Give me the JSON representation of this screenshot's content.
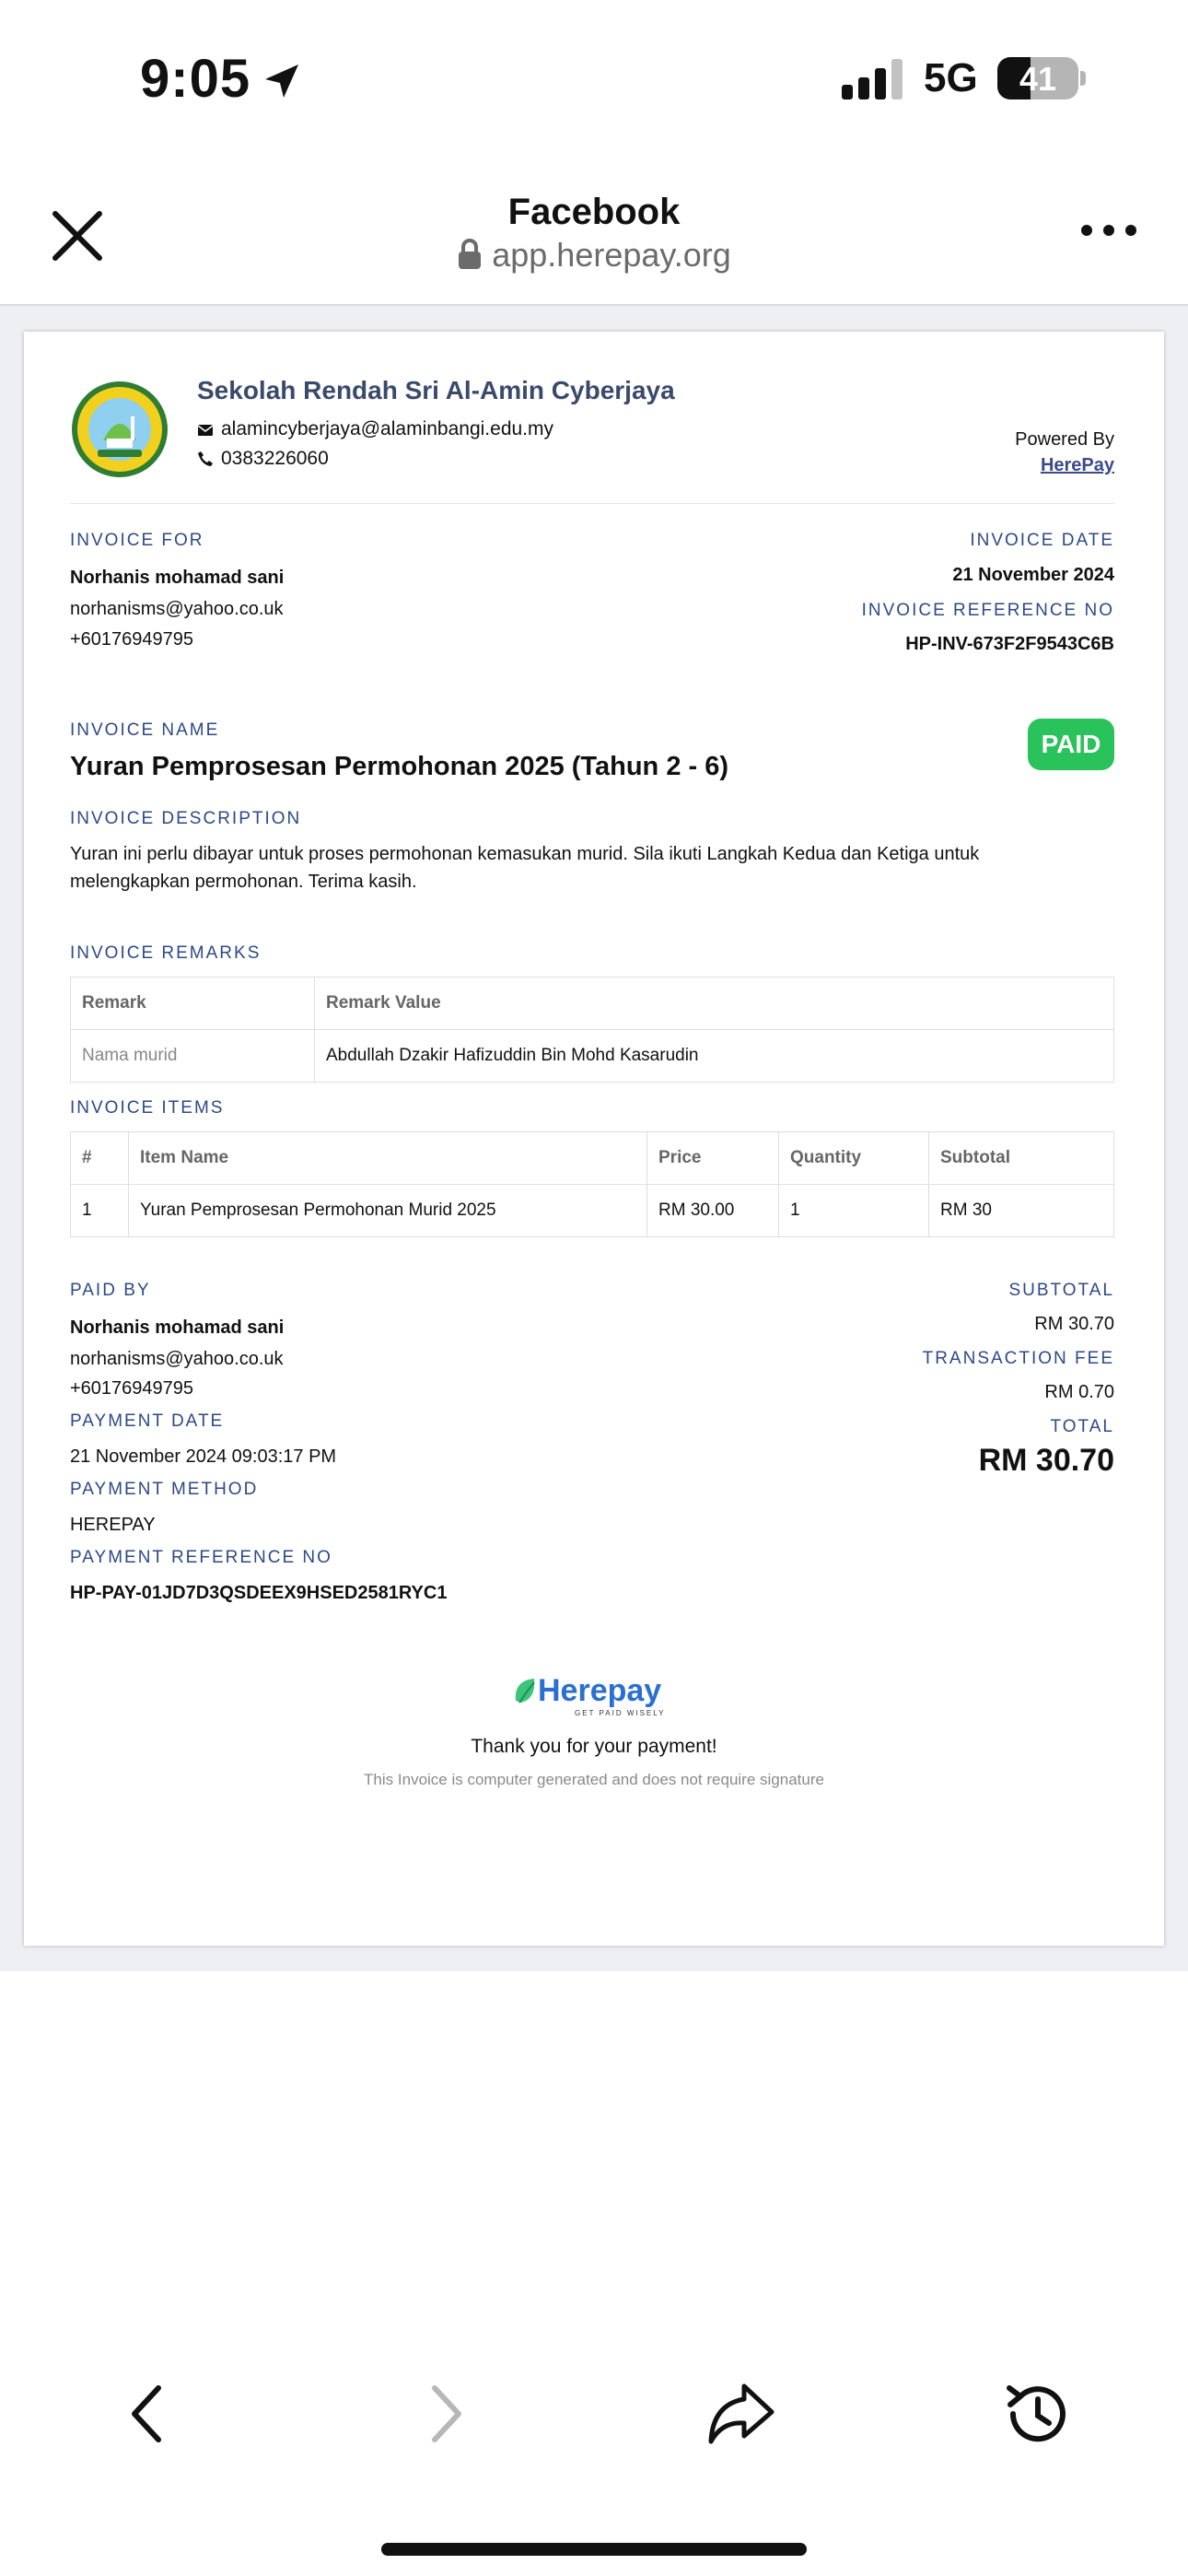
{
  "status_bar": {
    "time": "9:05",
    "network": "5G",
    "battery": "41",
    "battery_level": 0.41
  },
  "browser": {
    "title": "Facebook",
    "url": "app.herepay.org"
  },
  "invoice": {
    "school_name": "Sekolah Rendah Sri Al-Amin Cyberjaya",
    "school_email": "alamincyberjaya@alaminbangi.edu.my",
    "school_phone": "0383226060",
    "powered_by": "Powered By",
    "powered_link": "HerePay",
    "invoice_for_label": "INVOICE FOR",
    "customer_name": "Norhanis mohamad sani",
    "customer_email": "norhanisms@yahoo.co.uk",
    "customer_phone": "+60176949795",
    "invoice_date_label": "INVOICE DATE",
    "invoice_date": "21 November 2024",
    "ref_label": "INVOICE REFERENCE NO",
    "ref_no": "HP-INV-673F2F9543C6B",
    "name_label": "INVOICE NAME",
    "invoice_name": "Yuran Pemprosesan Permohonan 2025 (Tahun 2 - 6)",
    "status": "PAID",
    "desc_label": "INVOICE DESCRIPTION",
    "description": "Yuran ini perlu dibayar untuk proses permohonan kemasukan murid. Sila ikuti Langkah Kedua dan Ketiga untuk melengkapkan permohonan. Terima kasih.",
    "remarks_label": "INVOICE REMARKS",
    "remarks_headers": [
      "Remark",
      "Remark Value"
    ],
    "remarks_rows": [
      [
        "Nama murid",
        "Abdullah Dzakir Hafizuddin Bin Mohd Kasarudin"
      ]
    ],
    "items_label": "INVOICE ITEMS",
    "items_headers": [
      "#",
      "Item Name",
      "Price",
      "Quantity",
      "Subtotal"
    ],
    "items_rows": [
      [
        "1",
        "Yuran Pemprosesan Permohonan Murid 2025",
        "RM 30.00",
        "1",
        "RM 30"
      ]
    ],
    "paid_by_label": "PAID BY",
    "payer_name": "Norhanis mohamad sani",
    "payer_email": "norhanisms@yahoo.co.uk",
    "payer_phone": "+60176949795",
    "payment_date_label": "PAYMENT DATE",
    "payment_date": "21 November 2024 09:03:17 PM",
    "payment_method_label": "PAYMENT METHOD",
    "payment_method": "HEREPAY",
    "payment_ref_label": "PAYMENT REFERENCE NO",
    "payment_ref": "HP-PAY-01JD7D3QSDEEX9HSED2581RYC1",
    "subtotal_label": "SUBTOTAL",
    "subtotal": "RM 30.70",
    "fee_label": "TRANSACTION FEE",
    "fee": "RM 0.70",
    "total_label": "TOTAL",
    "total": "RM 30.70",
    "brand": "Herepay",
    "brand_tagline": "GET PAID WISELY",
    "thanks": "Thank you for your payment!",
    "note": "This Invoice is computer generated and does not require signature"
  }
}
